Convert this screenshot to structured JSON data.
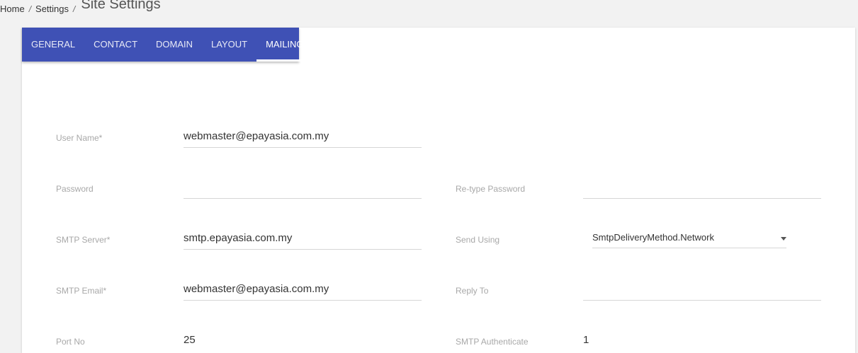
{
  "breadcrumb": {
    "home": "Home",
    "settings": "Settings",
    "separator": "/",
    "title": "Site Settings"
  },
  "tabs": [
    {
      "label": "GENERAL"
    },
    {
      "label": "CONTACT"
    },
    {
      "label": "DOMAIN"
    },
    {
      "label": "LAYOUT"
    },
    {
      "label": "MAILING",
      "active": true
    }
  ],
  "form": {
    "user_name": {
      "label": "User Name*",
      "value": "webmaster@epayasia.com.my"
    },
    "password": {
      "label": "Password",
      "value": ""
    },
    "retype_password": {
      "label": "Re-type Password",
      "value": ""
    },
    "smtp_server": {
      "label": "SMTP Server*",
      "value": "smtp.epayasia.com.my"
    },
    "send_using": {
      "label": "Send Using",
      "value": "SmtpDeliveryMethod.Network"
    },
    "smtp_email": {
      "label": "SMTP Email*",
      "value": "webmaster@epayasia.com.my"
    },
    "reply_to": {
      "label": "Reply To",
      "value": ""
    },
    "port_no": {
      "label": "Port No",
      "value": "25"
    },
    "smtp_authenticate": {
      "label": "SMTP Authenticate",
      "value": "1"
    }
  },
  "colors": {
    "tab_bar": "#3f51b5",
    "label": "#a8a8a8",
    "page_bg": "#f2f2f2"
  },
  "icons": {
    "select_caret": "caret-down-icon"
  }
}
